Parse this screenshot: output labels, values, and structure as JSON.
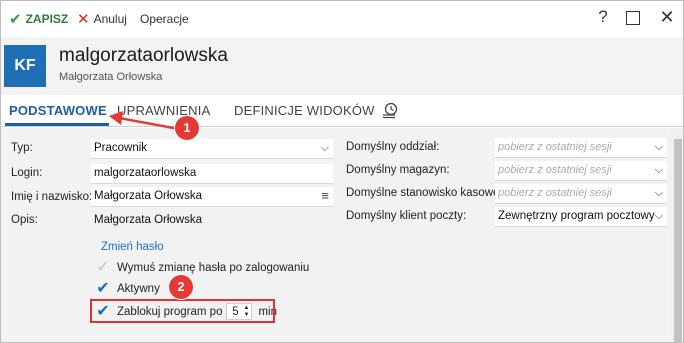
{
  "toolbar": {
    "save_label": "ZAPISZ",
    "cancel_label": "Anuluj",
    "operations_label": "Operacje",
    "help_glyph": "?",
    "close_glyph": "✕"
  },
  "header": {
    "avatar": "KF",
    "title": "malgorzataorlowska",
    "subtitle": "Małgorzata Orłowska"
  },
  "tabs": [
    {
      "label": "PODSTAWOWE"
    },
    {
      "label": "UPRAWNIENIA"
    },
    {
      "label": "DEFINICJE WIDOKÓW"
    }
  ],
  "left_form": {
    "type_label": "Typ:",
    "type_value": "Pracownik",
    "login_label": "Login:",
    "login_value": "malgorzataorlowska",
    "name_label": "Imię i nazwisko:",
    "name_value": "Małgorzata Orłowska",
    "desc_label": "Opis:",
    "desc_value": "Małgorzata Orłowska"
  },
  "right_form": {
    "branch_label": "Domyślny oddział:",
    "branch_placeholder": "pobierz z ostatniej sesji",
    "warehouse_label": "Domyślny magazyn:",
    "warehouse_placeholder": "pobierz z ostatniej sesji",
    "station_label": "Domyślne stanowisko kasowe:",
    "station_placeholder": "pobierz z ostatniej sesji",
    "mail_label": "Domyślny klient poczty:",
    "mail_value": "Zewnętrzny program pocztowy"
  },
  "options": {
    "change_password": "Zmień hasło",
    "force_change": {
      "label": "Wymuś zmianę hasła po zalogowaniu",
      "checked": false
    },
    "active": {
      "label": "Aktywny",
      "checked": true
    },
    "lock": {
      "label": "Zablokuj program po",
      "checked": true,
      "minutes": "5",
      "unit": "min"
    }
  },
  "annotations": {
    "badge1": "1",
    "badge2": "2",
    "accent": "#e53935"
  },
  "colors": {
    "brand": "#1e6fb5",
    "tab_active": "#1b5fa8",
    "save": "#2e7d32",
    "cancel": "#d32f2f"
  }
}
